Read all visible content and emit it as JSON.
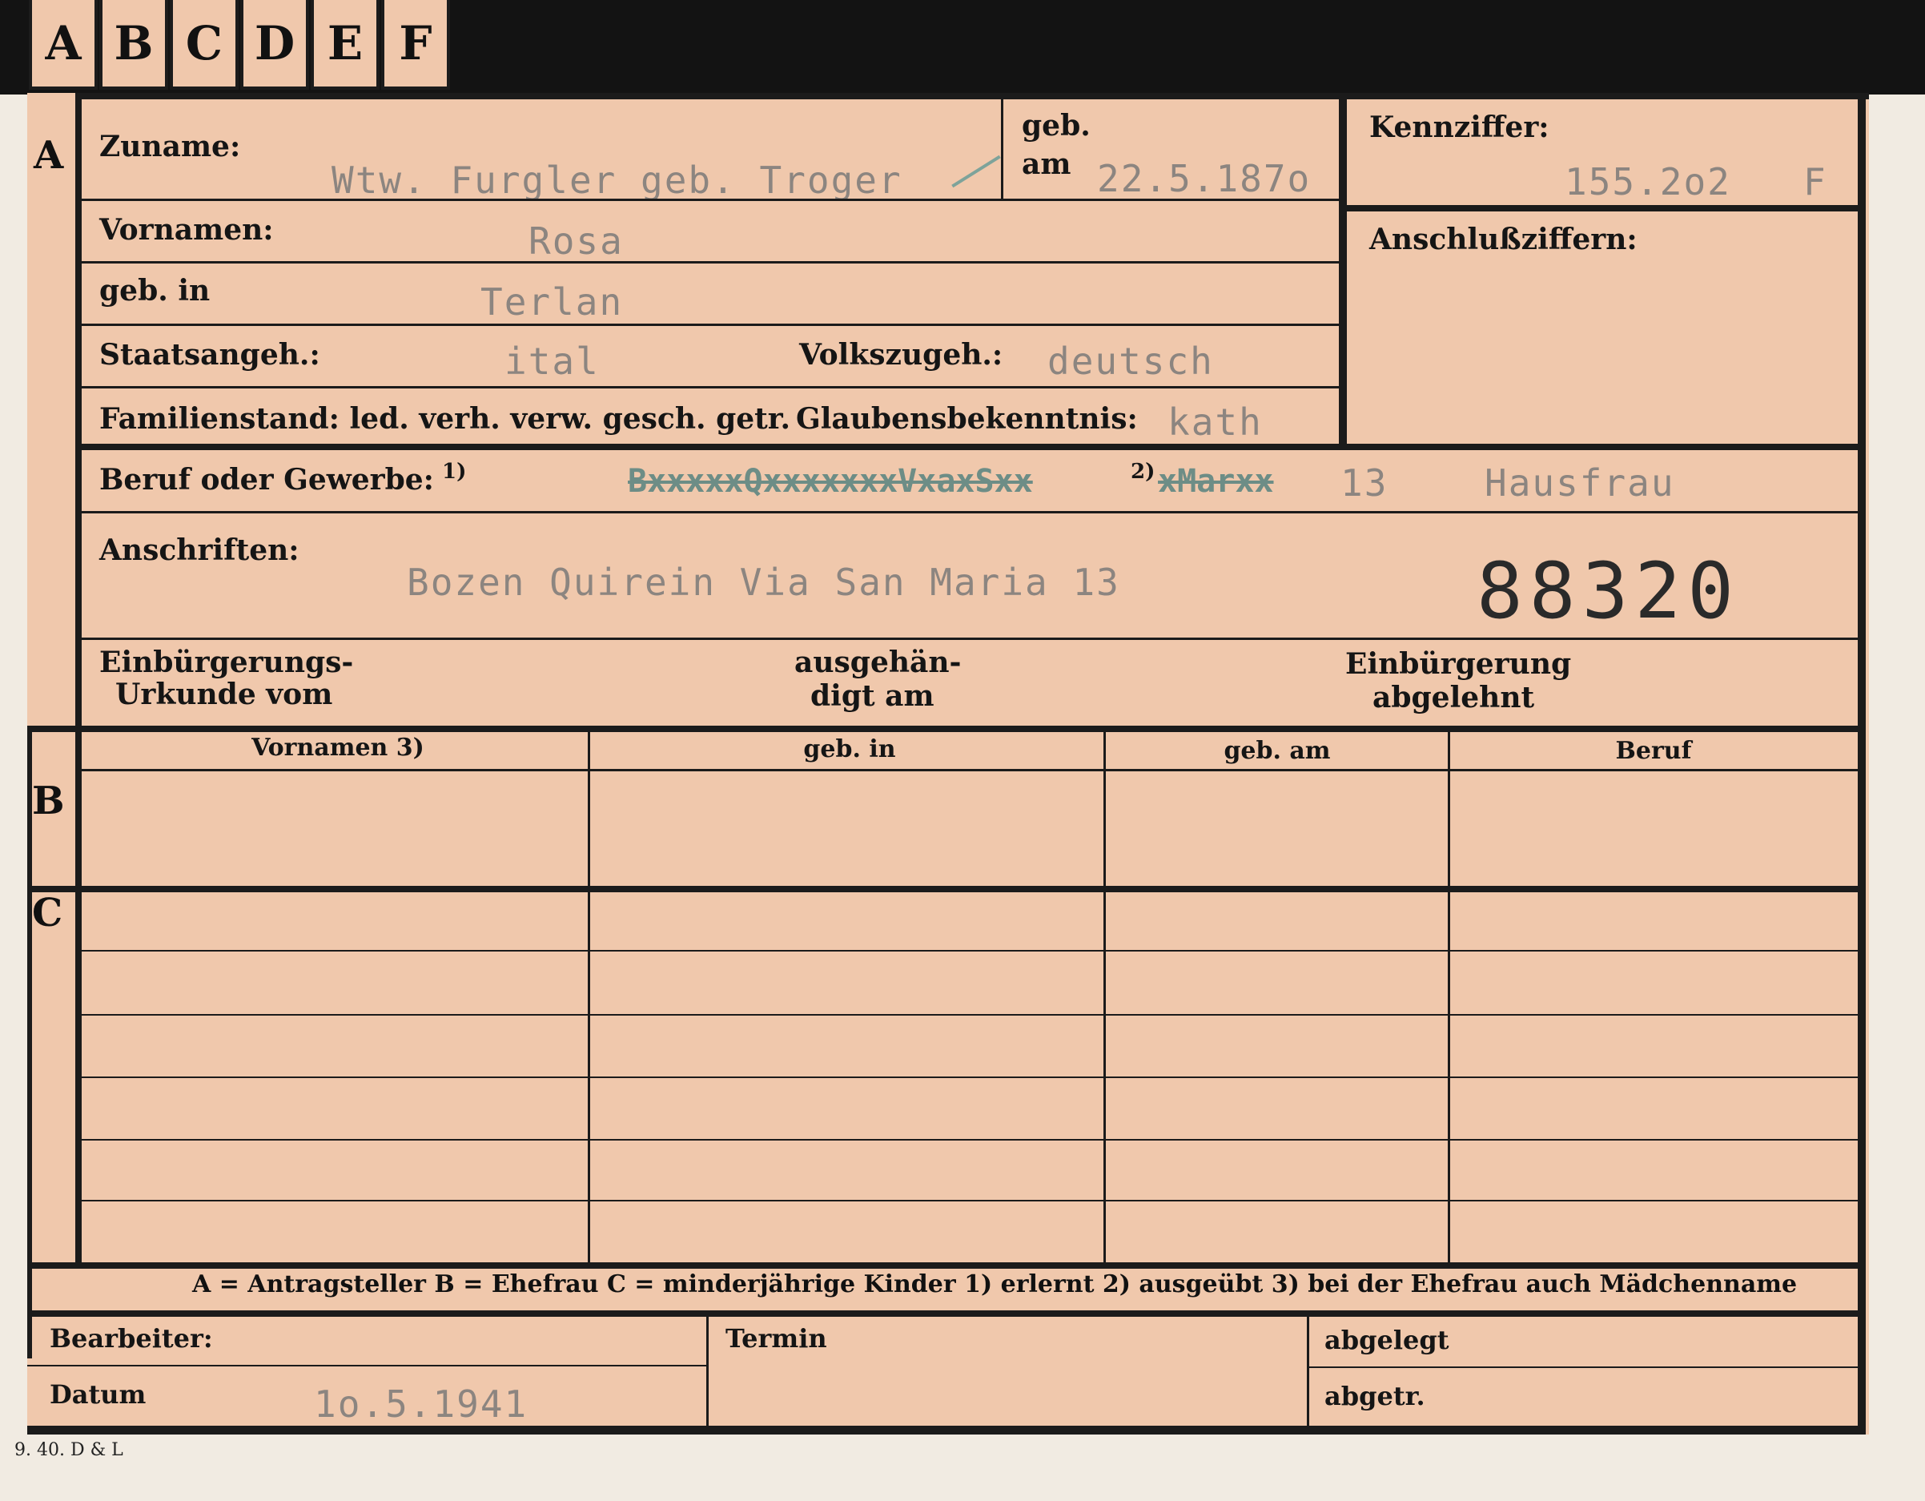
{
  "tabs": [
    "A",
    "B",
    "C",
    "D",
    "E",
    "F"
  ],
  "sections": {
    "a": "A",
    "b": "B",
    "c": "C"
  },
  "section_a": {
    "surname_label": "Zuname:",
    "surname_value": "Wtw. Furgler geb. Troger",
    "born_label_1": "geb.",
    "born_label_2": "am",
    "born_value": "22.5.187o",
    "first_names_label": "Vornamen:",
    "first_names_value": "Rosa",
    "birthplace_label": "geb. in",
    "birthplace_value": "Terlan",
    "citizenship_label": "Staatsangeh.:",
    "citizenship_value": "ital",
    "ethnicity_label": "Volkszugeh.:",
    "ethnicity_value": "deutsch",
    "marital_label": "Familienstand: led. verh. verw. gesch. getr.",
    "religion_label": "Glaubensbekenntnis:",
    "religion_value": "kath",
    "occupation_label": "Beruf oder Gewerbe:",
    "occupation_note": "1)",
    "occupation_struck": "BxxxxxQxxxxxxxVxaxSxx",
    "occupation_note2": "2)",
    "occupation_struck2": "xMarxx",
    "occupation_number": "13",
    "occupation_value": "Hausfrau",
    "addresses_label": "Anschriften:",
    "addresses_value": "Bozen Quirein Via San Maria 13",
    "file_number": "88320",
    "naturalization_label_1": "Einbürgerungs-",
    "naturalization_label_2": "Urkunde vom",
    "handed_label_1": "ausgehän-",
    "handed_label_2": "digt am",
    "refused_label_1": "Einbürgerung",
    "refused_label_2": "abgelehnt",
    "kennziffer_label": "Kennziffer:",
    "kennziffer_value": "155.2o2",
    "kennziffer_suffix": "F",
    "anschluss_label": "Anschlußziffern:"
  },
  "table": {
    "headers": [
      "Vornamen 3)",
      "geb. in",
      "geb. am",
      "Beruf"
    ]
  },
  "legend": {
    "text": "A = Antragsteller   B = Ehefrau   C = minderjährige Kinder   1) erlernt   2) ausgeübt   3) bei der Ehefrau auch Mädchenname"
  },
  "footer": {
    "clerk_label": "Bearbeiter:",
    "date_label": "Datum",
    "date_value": "1o.5.1941",
    "deadline_label": "Termin",
    "filed_label": "abgelegt",
    "sent_label": "abgetr.",
    "print_mark": "9. 40.  D & L"
  }
}
